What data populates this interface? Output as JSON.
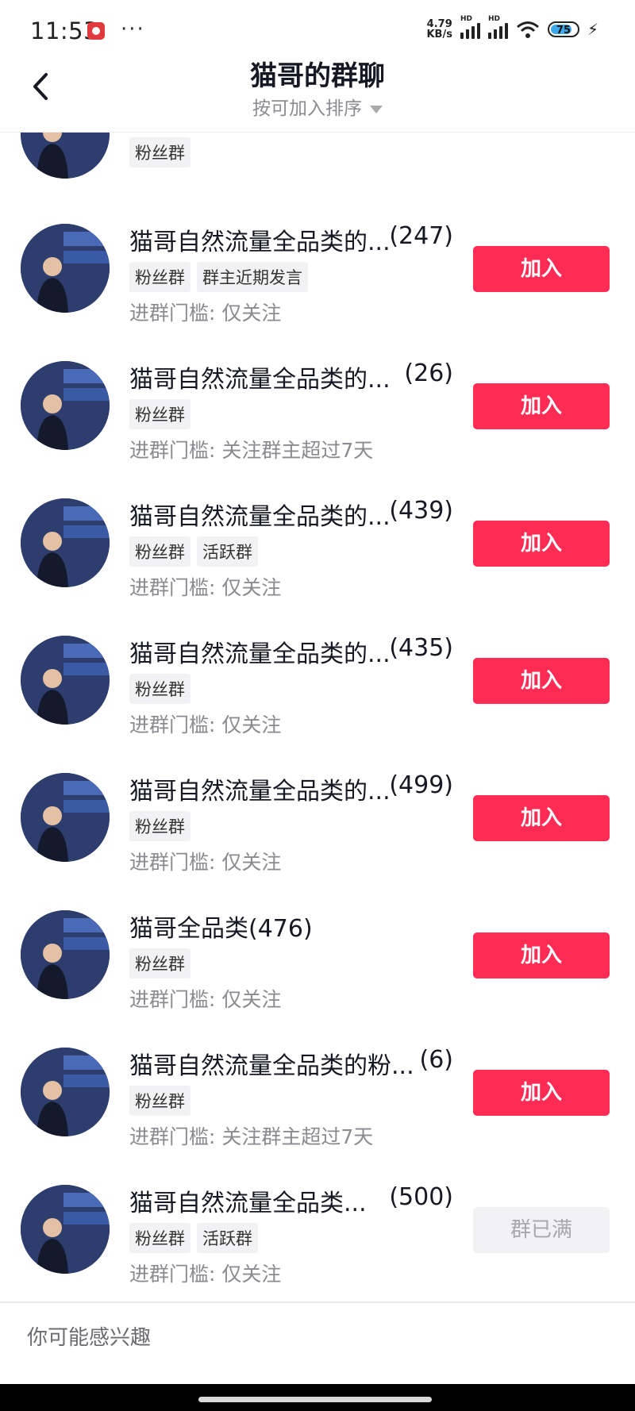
{
  "status_bar": {
    "time": "11:53",
    "net_speed_value": "4.79",
    "net_speed_unit": "KB/s",
    "signal_label_1": "HD",
    "signal_label_2": "HD",
    "battery": "75"
  },
  "header": {
    "title": "猫哥的群聊",
    "sort_label": "按可加入排序"
  },
  "groups": [
    {
      "name": "",
      "count": "",
      "tags": [
        "粉丝群"
      ],
      "requirement": "",
      "button": ""
    },
    {
      "name": "猫哥自然流量全品类的...",
      "count": "(247)",
      "tags": [
        "粉丝群",
        "群主近期发言"
      ],
      "requirement": "进群门槛: 仅关注",
      "button": "加入"
    },
    {
      "name": "猫哥自然流量全品类的...",
      "count": "(26)",
      "tags": [
        "粉丝群"
      ],
      "requirement": "进群门槛: 关注群主超过7天",
      "button": "加入"
    },
    {
      "name": "猫哥自然流量全品类的...",
      "count": "(439)",
      "tags": [
        "粉丝群",
        "活跃群"
      ],
      "requirement": "进群门槛: 仅关注",
      "button": "加入"
    },
    {
      "name": "猫哥自然流量全品类的...",
      "count": "(435)",
      "tags": [
        "粉丝群"
      ],
      "requirement": "进群门槛: 仅关注",
      "button": "加入"
    },
    {
      "name": "猫哥自然流量全品类的...",
      "count": "(499)",
      "tags": [
        "粉丝群"
      ],
      "requirement": "进群门槛: 仅关注",
      "button": "加入"
    },
    {
      "name": "猫哥全品类(476)",
      "count": "",
      "tags": [
        "粉丝群"
      ],
      "requirement": "进群门槛: 仅关注",
      "button": "加入"
    },
    {
      "name": "猫哥自然流量全品类的粉...",
      "count": "(6)",
      "tags": [
        "粉丝群"
      ],
      "requirement": "进群门槛: 关注群主超过7天",
      "button": "加入"
    },
    {
      "name": "猫哥自然流量全品类...",
      "count": "(500)",
      "tags": [
        "粉丝群",
        "活跃群"
      ],
      "requirement": "进群门槛: 仅关注",
      "button": "群已满",
      "full": true
    }
  ],
  "bottom": {
    "interest_label": "你可能感兴趣"
  },
  "colors": {
    "join_button": "#fe2c55",
    "full_button": "#f2f2f4",
    "tag_bg": "#f2f2f4",
    "secondary_text": "#8a8b91"
  }
}
